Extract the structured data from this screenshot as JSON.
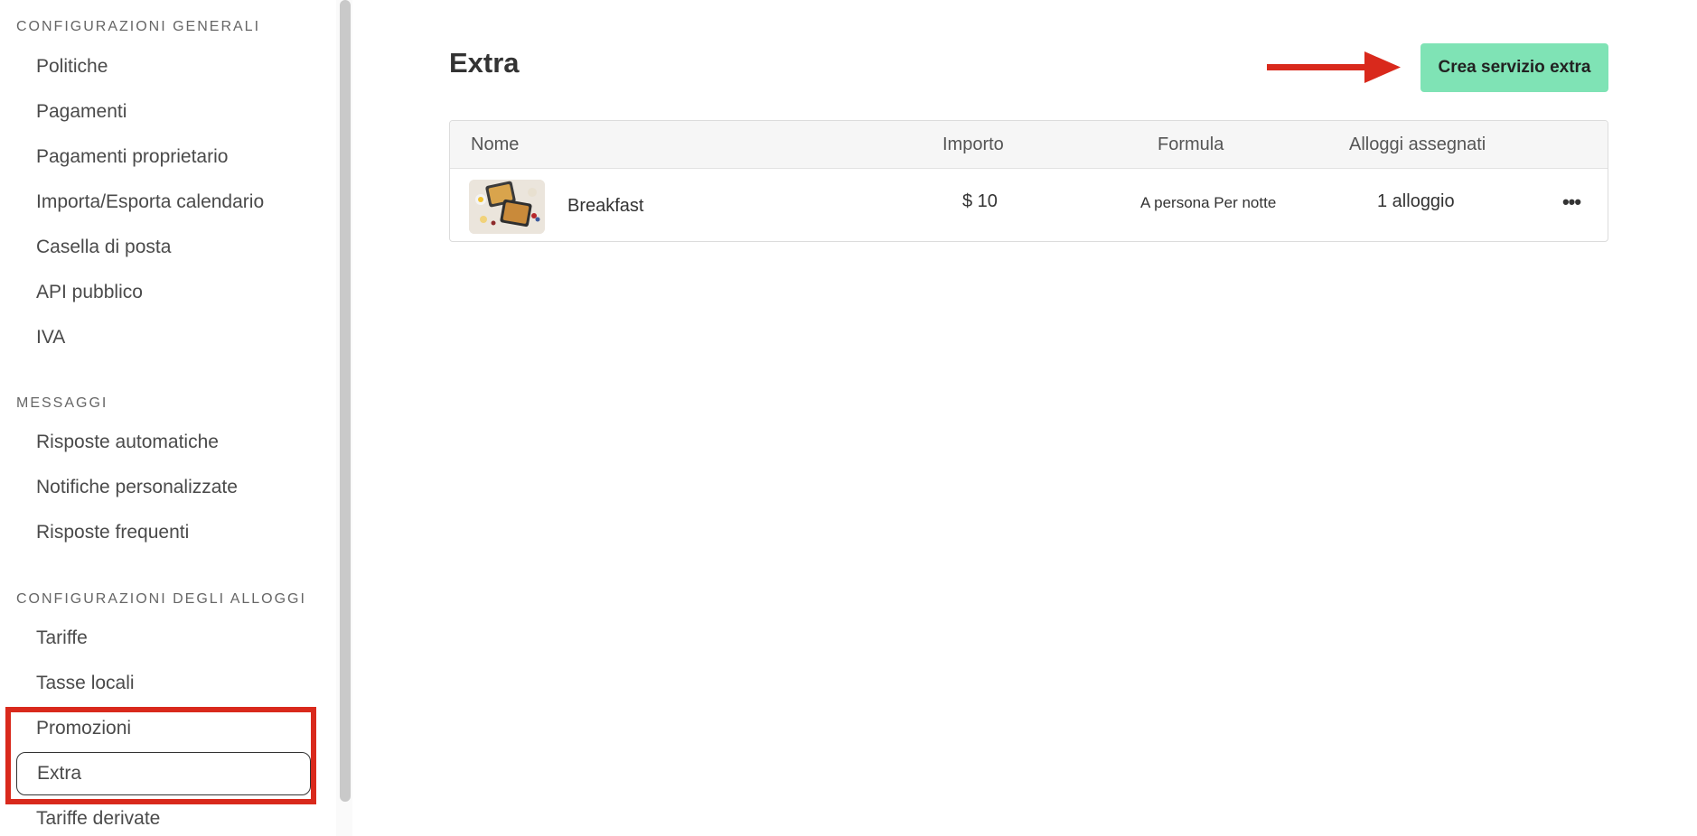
{
  "sidebar": {
    "sections": [
      {
        "title": "CONFIGURAZIONI GENERALI",
        "items": [
          "Politiche",
          "Pagamenti",
          "Pagamenti proprietario",
          "Importa/Esporta calendario",
          "Casella di posta",
          "API pubblico",
          "IVA"
        ]
      },
      {
        "title": "MESSAGGI",
        "items": [
          "Risposte automatiche",
          "Notifiche personalizzate",
          "Risposte frequenti"
        ]
      },
      {
        "title": "CONFIGURAZIONI DEGLI ALLOGGI",
        "items": [
          "Tariffe",
          "Tasse locali",
          "Promozioni",
          "Extra",
          "Tariffe derivate"
        ]
      }
    ],
    "active_item": "Extra"
  },
  "main": {
    "title": "Extra",
    "create_button_label": "Crea servizio extra",
    "table": {
      "headers": [
        "Nome",
        "Importo",
        "Formula",
        "Alloggi assegnati"
      ],
      "rows": [
        {
          "name": "Breakfast",
          "amount": "$ 10",
          "formula": "A persona Per notte",
          "assigned": "1 alloggio",
          "more": "•••"
        }
      ]
    }
  },
  "colors": {
    "accent_button": "#7fe3b5",
    "annotation_red": "#d9291c"
  },
  "icons": {
    "annotation_arrow": "arrow-right-icon",
    "row_menu": "more-horizontal-icon"
  }
}
